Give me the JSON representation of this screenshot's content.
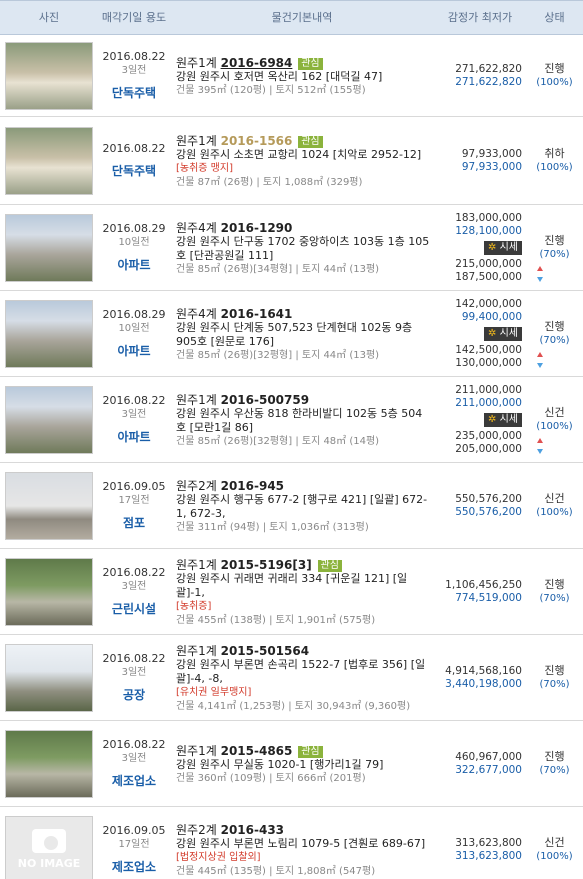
{
  "headers": {
    "photo": "사진",
    "date": "매각기일 용도",
    "info": "물건기본내역",
    "price": "감정가 최저가",
    "status": "상태"
  },
  "rows": [
    {
      "date": "2016.08.22",
      "days": "3일전",
      "type": "단독주택",
      "court": "원주1계",
      "case_no": "2016-6984",
      "interest": "관심",
      "address": "강원 원주시 호저면 옥산리 162 [대덕길 47]",
      "warn": "",
      "size": "건물 395㎡ (120평) | 토지 512㎡ (155평)",
      "appraisal": "271,622,820",
      "minimum": "271,622,820",
      "market": "",
      "market_high": "",
      "market_low": "",
      "status": "진행",
      "percent": "(100%)",
      "thumb": "house-photo"
    },
    {
      "date": "2016.08.22",
      "days": "",
      "type": "단독주택",
      "court": "원주1계",
      "case_no": "2016-1566",
      "interest": "관심",
      "address": "강원 원주시 소초면 교항리 1024 [치악로 2952-12]",
      "warn": "[농취증  맹지]",
      "size": "건물 87㎡ (26평) | 토지 1,088㎡ (329평)",
      "appraisal": "97,933,000",
      "minimum": "97,933,000",
      "market": "",
      "market_high": "",
      "market_low": "",
      "status": "취하",
      "percent": "(100%)",
      "thumb": "house-photo"
    },
    {
      "date": "2016.08.29",
      "days": "10일전",
      "type": "아파트",
      "court": "원주4계",
      "case_no": "2016-1290",
      "interest": "",
      "address": "강원 원주시 단구동 1702 중앙하이츠 103동 1층 105호 [단관공원길 111]",
      "warn": "",
      "size": "건물 85㎡ (26평)[34평형] | 토지 44㎡ (13평)",
      "appraisal": "183,000,000",
      "minimum": "128,100,000",
      "market": "시세",
      "market_high": "215,000,000",
      "market_low": "187,500,000",
      "status": "진행",
      "percent": "(70%)",
      "thumb": "apartment-photo"
    },
    {
      "date": "2016.08.29",
      "days": "10일전",
      "type": "아파트",
      "court": "원주4계",
      "case_no": "2016-1641",
      "interest": "",
      "address": "강원 원주시 단계동 507,523 단계현대 102동 9층 905호 [원문로 176]",
      "warn": "",
      "size": "건물 85㎡ (26평)[32평형] | 토지 44㎡ (13평)",
      "appraisal": "142,000,000",
      "minimum": "99,400,000",
      "market": "시세",
      "market_high": "142,500,000",
      "market_low": "130,000,000",
      "status": "진행",
      "percent": "(70%)",
      "thumb": "apartment-photo"
    },
    {
      "date": "2016.08.22",
      "days": "3일전",
      "type": "아파트",
      "court": "원주1계",
      "case_no": "2016-500759",
      "interest": "",
      "address": "강원 원주시 우산동 818 한라비발디 102동 5층 504호 [모란1길 86]",
      "warn": "",
      "size": "건물 85㎡ (26평)[32평형] | 토지 48㎡ (14평)",
      "appraisal": "211,000,000",
      "minimum": "211,000,000",
      "market": "시세",
      "market_high": "235,000,000",
      "market_low": "205,000,000",
      "status": "신건",
      "percent": "(100%)",
      "thumb": "apartment-photo"
    },
    {
      "date": "2016.09.05",
      "days": "17일전",
      "type": "점포",
      "court": "원주2계",
      "case_no": "2016-945",
      "interest": "",
      "address": "강원 원주시 행구동 677-2 [행구로 421] [일괄] 672-1, 672-3,",
      "warn": "",
      "size": "건물 311㎡ (94평) | 토지 1,036㎡ (313평)",
      "appraisal": "550,576,200",
      "minimum": "550,576,200",
      "market": "",
      "market_high": "",
      "market_low": "",
      "status": "신건",
      "percent": "(100%)",
      "thumb": "store-photo"
    },
    {
      "date": "2016.08.22",
      "days": "3일전",
      "type": "근린시설",
      "court": "원주1계",
      "case_no": "2015-5196[3]",
      "interest": "관심",
      "address": "강원 원주시 귀래면 귀래리 334 [귀운길 121] [일괄]-1,",
      "warn": "[농취증]",
      "size": "건물 455㎡ (138평) | 토지 1,901㎡ (575평)",
      "appraisal": "1,106,456,250",
      "minimum": "774,519,000",
      "market": "",
      "market_high": "",
      "market_low": "",
      "status": "진행",
      "percent": "(70%)",
      "thumb": "facility-photo"
    },
    {
      "date": "2016.08.22",
      "days": "3일전",
      "type": "공장",
      "court": "원주1계",
      "case_no": "2015-501564",
      "interest": "",
      "address": "강원 원주시 부론면 손곡리 1522-7 [법후로 356] [일괄]-4, -8,",
      "warn": "[유치권  일부맹지]",
      "size": "건물 4,141㎡ (1,253평) | 토지 30,943㎡ (9,360평)",
      "appraisal": "4,914,568,160",
      "minimum": "3,440,198,000",
      "market": "",
      "market_high": "",
      "market_low": "",
      "status": "진행",
      "percent": "(70%)",
      "thumb": "factory-photo"
    },
    {
      "date": "2016.08.22",
      "days": "3일전",
      "type": "제조업소",
      "court": "원주1계",
      "case_no": "2015-4865",
      "interest": "관심",
      "address": "강원 원주시 무실동 1020-1 [행가리1길 79]",
      "warn": "",
      "size": "건물 360㎡ (109평) | 토지 666㎡ (201평)",
      "appraisal": "460,967,000",
      "minimum": "322,677,000",
      "market": "",
      "market_high": "",
      "market_low": "",
      "status": "진행",
      "percent": "(70%)",
      "thumb": "facility-photo"
    },
    {
      "date": "2016.09.05",
      "days": "17일전",
      "type": "제조업소",
      "court": "원주2계",
      "case_no": "2016-433",
      "interest": "",
      "address": "강원 원주시 부론면 노림리 1079-5 [견훤로 689-67]",
      "warn": "[법정지상권  입찰외]",
      "size": "건물 445㎡ (135평) | 토지 1,808㎡ (547평)",
      "appraisal": "313,623,800",
      "minimum": "313,623,800",
      "market": "",
      "market_high": "",
      "market_low": "",
      "status": "신건",
      "percent": "(100%)",
      "thumb": "no-image",
      "noimage_label": "NO IMAGE"
    }
  ]
}
